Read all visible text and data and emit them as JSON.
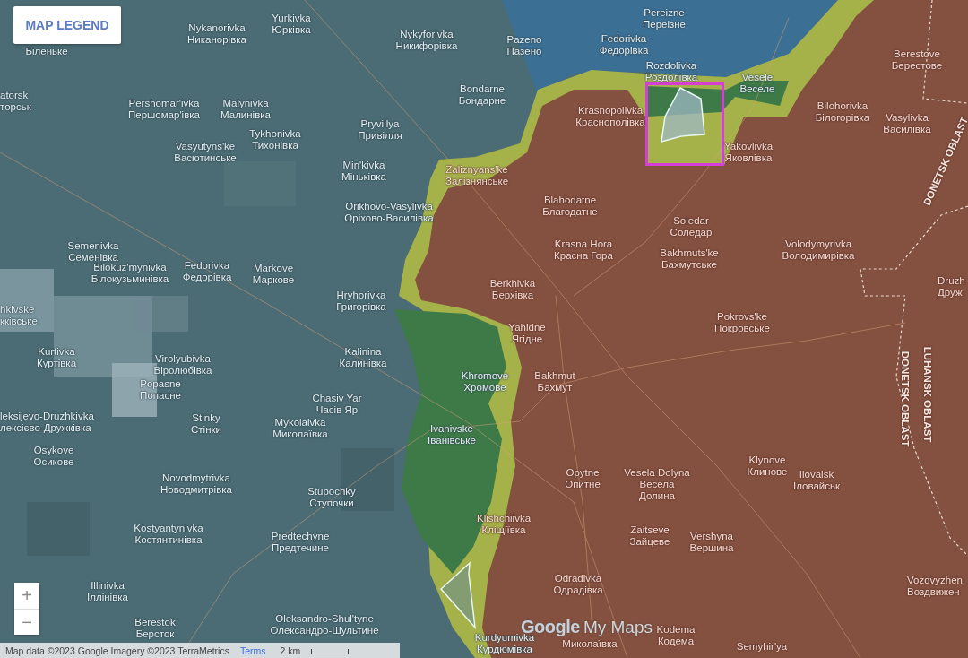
{
  "legend_button": {
    "label": "MAP LEGEND"
  },
  "places": [
    {
      "name": "Yurkivka",
      "name_local": "Юрківка"
    },
    {
      "name": "Pereizne",
      "name_local": "Переізне"
    },
    {
      "name": "Nykanorivka",
      "name_local": "Никанорівка"
    },
    {
      "name": "Nykyforivka",
      "name_local": "Никифорівка"
    },
    {
      "name_local": "Біленьке"
    },
    {
      "name": "Pazeno",
      "name_local": "Пазено"
    },
    {
      "name": "Fedorivka",
      "name_local": "Федорівка"
    },
    {
      "name": "Berestove",
      "name_local": "Берестове"
    },
    {
      "name": "Rozdolivka",
      "name_local": "Роздолівка"
    },
    {
      "name": "Vesele",
      "name_local": "Веселе"
    },
    {
      "name": "atorsk",
      "name_local": "торськ"
    },
    {
      "name": "Bondarne",
      "name_local": "Бондарне"
    },
    {
      "name": "Pershomar'ivka",
      "name_local": "Першомар'івка"
    },
    {
      "name": "Malynivka",
      "name_local": "Малинівка"
    },
    {
      "name": "Krasnopolivka",
      "name_local": "Краснополівка"
    },
    {
      "name": "Bilohorivka",
      "name_local": "Білогорівка"
    },
    {
      "name": "Pryvillya",
      "name_local": "Привілля"
    },
    {
      "name": "Vasylivka",
      "name_local": "Василівка"
    },
    {
      "name": "Tykhonivka",
      "name_local": "Тихонівка"
    },
    {
      "name": "Vasyutyns'ke",
      "name_local": "Васютинське"
    },
    {
      "name": "Yakovlivka",
      "name_local": "Яковлівка"
    },
    {
      "name": "Min'kivka",
      "name_local": "Міньківка"
    },
    {
      "name": "Zaliznyans'ke",
      "name_local": "Залізнянське"
    },
    {
      "name": "Orikhovo-Vasylivka",
      "name_local": "Оріхово-Василівка"
    },
    {
      "name": "Blahodatne",
      "name_local": "Благодатне"
    },
    {
      "name": "Soledar",
      "name_local": "Соледар"
    },
    {
      "name": "Semenivka",
      "name_local": "Семенівка"
    },
    {
      "name": "Krasna Hora",
      "name_local": "Красна Гора"
    },
    {
      "name": "Volodymyrivka",
      "name_local": "Володимирівка"
    },
    {
      "name": "Bakhmuts'ke",
      "name_local": "Бахмутське"
    },
    {
      "name": "Bilokuz'mynivka",
      "name_local": "Білокузьминівка"
    },
    {
      "name": "Fedorivka",
      "name_local": "Федорівка"
    },
    {
      "name": "Markove",
      "name_local": "Маркове"
    },
    {
      "name": "Berkhivka",
      "name_local": "Берхівка"
    },
    {
      "name": "Druzh",
      "name_local": "Друж"
    },
    {
      "name": "Hryhorivka",
      "name_local": "Григорівка"
    },
    {
      "name": "hkivske",
      "name_local": "кківське"
    },
    {
      "name": "Pokrovs'ke",
      "name_local": "Покровське"
    },
    {
      "name": "Yahidne",
      "name_local": "Ягідне"
    },
    {
      "name": "Kurtivka",
      "name_local": "Куртівка"
    },
    {
      "name": "Virolyubivka",
      "name_local": "Віролюбівка"
    },
    {
      "name": "Kalinina",
      "name_local": "Калинівка"
    },
    {
      "name": "Khromove",
      "name_local": "Хромове"
    },
    {
      "name": "Bakhmut",
      "name_local": "Бахмут"
    },
    {
      "name": "Popasne",
      "name_local": "Попасне"
    },
    {
      "name": "Chasiv Yar",
      "name_local": "Часів Яр"
    },
    {
      "name": "leksijevo-Druzhkivka",
      "name_local": "лексієво-Дружківка"
    },
    {
      "name": "Stinky",
      "name_local": "Стінки"
    },
    {
      "name": "Mykolaivka",
      "name_local": "Миколаївка"
    },
    {
      "name": "Ivanivske",
      "name_local": "Іванівське"
    },
    {
      "name": "Osykove",
      "name_local": "Осикове"
    },
    {
      "name": "Klynove",
      "name_local": "Клинове"
    },
    {
      "name": "Novodmytrivka",
      "name_local": "Новодмитрівка"
    },
    {
      "name": "Opytne",
      "name_local": "Опитне"
    },
    {
      "name": "Vesela Dolyna",
      "name_local": "Весела Долина"
    },
    {
      "name": "Ilovaisk",
      "name_local": "Іловайськ"
    },
    {
      "name": "Stupochky",
      "name_local": "Ступочки"
    },
    {
      "name": "Klishchiivka",
      "name_local": "Кліщіївка"
    },
    {
      "name": "Kostyantynivka",
      "name_local": "Костянтинівка"
    },
    {
      "name": "Predtechyne",
      "name_local": "Предтечине"
    },
    {
      "name": "Zaitseve",
      "name_local": "Зайцеве"
    },
    {
      "name": "Vershyna",
      "name_local": "Вершина"
    },
    {
      "name": "Illinivka",
      "name_local": "Іллінівка"
    },
    {
      "name": "Odradivka",
      "name_local": "Одрадівка"
    },
    {
      "name": "Vozdvyzhen",
      "name_local": "Воздвижен"
    },
    {
      "name": "Berestok",
      "name_local": "Берсток"
    },
    {
      "name": "Oleksandro-Shul'tyne",
      "name_local": "Олександро-Шультине"
    },
    {
      "name": "Kurdyumivka",
      "name_local": "Курдюмівка"
    },
    {
      "name_local": "Миколаївка"
    },
    {
      "name": "Kodema",
      "name_local": "Кодема"
    },
    {
      "name": "Semyhir'ya"
    }
  ],
  "region_labels": [
    {
      "label": "DONETSK OBLAST"
    },
    {
      "label": "LUHANSK OBLAST"
    },
    {
      "label": "DONETSK OBLAST"
    }
  ],
  "zoom_controls": [
    {
      "label": "+"
    },
    {
      "label": "−"
    }
  ],
  "branding": {
    "logo": "Google",
    "product": "My Maps"
  },
  "footer": {
    "attribution": "Map data ©2023 Google Imagery ©2023 TerraMetrics",
    "terms": "Terms",
    "scale": "2 km"
  }
}
